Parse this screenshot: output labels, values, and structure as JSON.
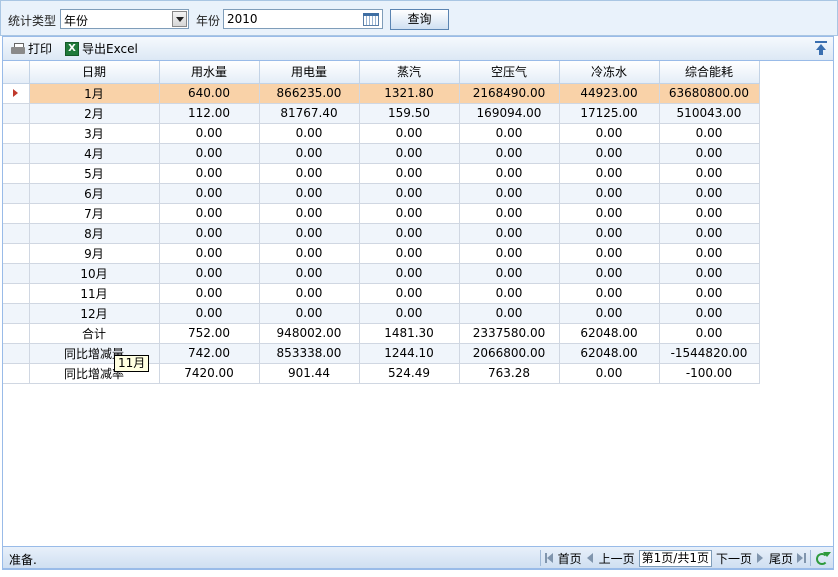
{
  "filters": {
    "stat_type_label": "统计类型",
    "stat_type_value": "年份",
    "year_label": "年份",
    "year_value": "2010",
    "query_label": "查询"
  },
  "toolbar": {
    "print_label": "打印",
    "export_label": "导出Excel"
  },
  "table": {
    "headers": [
      "日期",
      "用水量",
      "用电量",
      "蒸汽",
      "空压气",
      "冷冻水",
      "综合能耗"
    ],
    "rows": [
      [
        "1月",
        "640.00",
        "866235.00",
        "1321.80",
        "2168490.00",
        "44923.00",
        "63680800.00"
      ],
      [
        "2月",
        "112.00",
        "81767.40",
        "159.50",
        "169094.00",
        "17125.00",
        "510043.00"
      ],
      [
        "3月",
        "0.00",
        "0.00",
        "0.00",
        "0.00",
        "0.00",
        "0.00"
      ],
      [
        "4月",
        "0.00",
        "0.00",
        "0.00",
        "0.00",
        "0.00",
        "0.00"
      ],
      [
        "5月",
        "0.00",
        "0.00",
        "0.00",
        "0.00",
        "0.00",
        "0.00"
      ],
      [
        "6月",
        "0.00",
        "0.00",
        "0.00",
        "0.00",
        "0.00",
        "0.00"
      ],
      [
        "7月",
        "0.00",
        "0.00",
        "0.00",
        "0.00",
        "0.00",
        "0.00"
      ],
      [
        "8月",
        "0.00",
        "0.00",
        "0.00",
        "0.00",
        "0.00",
        "0.00"
      ],
      [
        "9月",
        "0.00",
        "0.00",
        "0.00",
        "0.00",
        "0.00",
        "0.00"
      ],
      [
        "10月",
        "0.00",
        "0.00",
        "0.00",
        "0.00",
        "0.00",
        "0.00"
      ],
      [
        "11月",
        "0.00",
        "0.00",
        "0.00",
        "0.00",
        "0.00",
        "0.00"
      ],
      [
        "12月",
        "0.00",
        "0.00",
        "0.00",
        "0.00",
        "0.00",
        "0.00"
      ],
      [
        "合计",
        "752.00",
        "948002.00",
        "1481.30",
        "2337580.00",
        "62048.00",
        "0.00"
      ],
      [
        "同比增减量",
        "742.00",
        "853338.00",
        "1244.10",
        "2066800.00",
        "62048.00",
        "-1544820.00"
      ],
      [
        "同比增减率",
        "7420.00",
        "901.44",
        "524.49",
        "763.28",
        "0.00",
        "-100.00"
      ]
    ],
    "selected_row": 0
  },
  "tooltip": "11月",
  "status": {
    "text": "准备.",
    "first": "首页",
    "prev": "上一页",
    "page_indicator": "第1页/共1页",
    "next": "下一页",
    "last": "尾页"
  },
  "colors": {
    "selected_row": "#f9d2a8",
    "alt_row": "#f0f5fb",
    "header_border": "#99bbe8"
  }
}
